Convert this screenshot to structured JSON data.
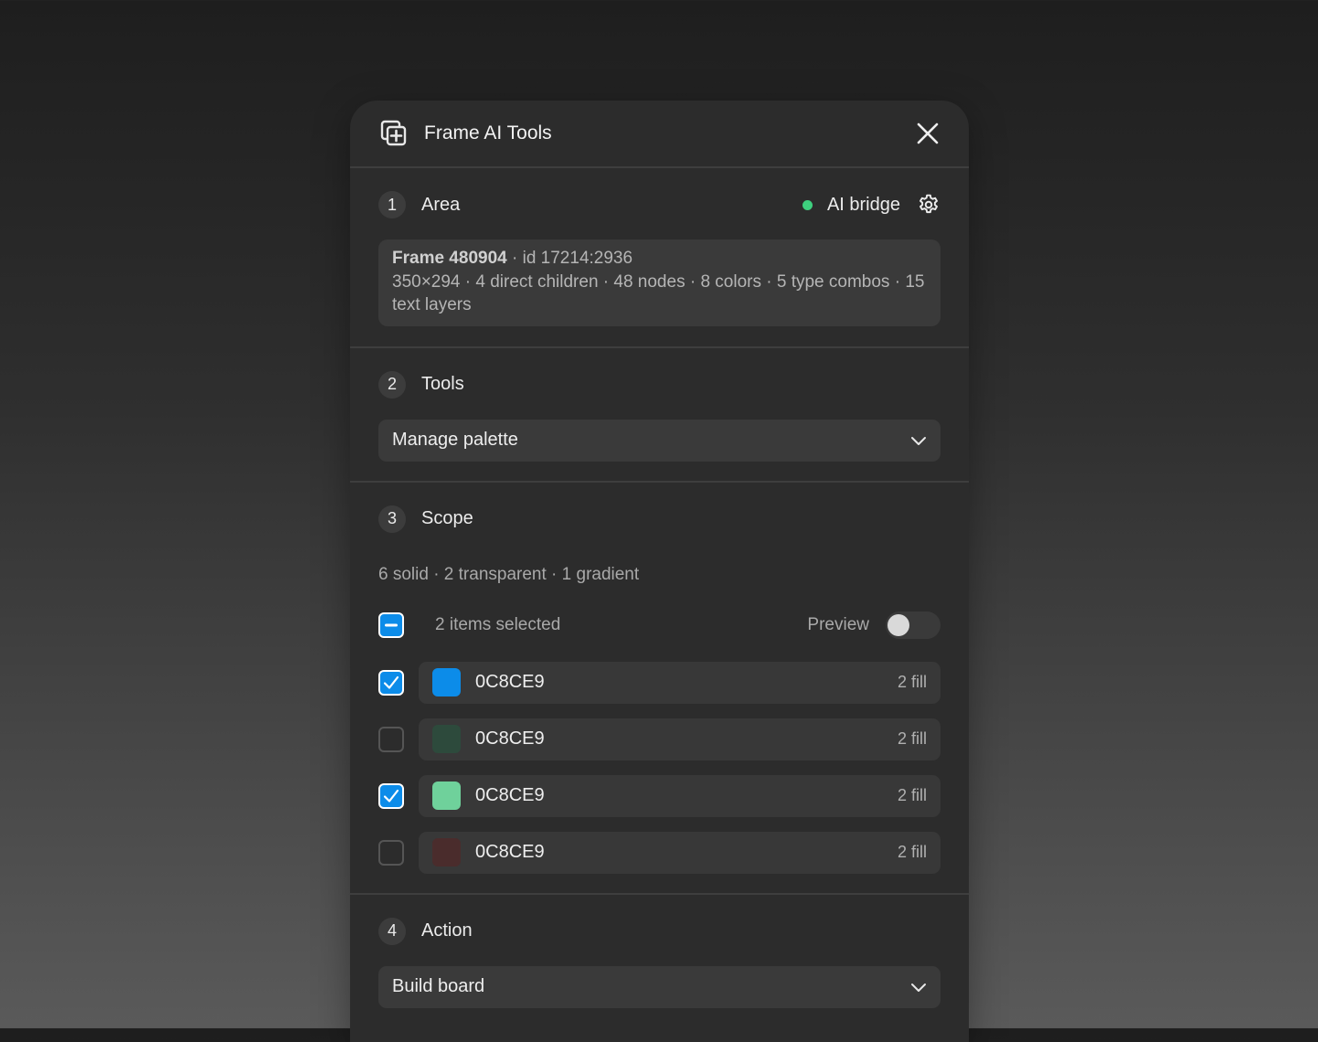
{
  "header": {
    "title": "Frame AI Tools"
  },
  "area": {
    "number": "1",
    "title": "Area",
    "status_label": "AI bridge",
    "status_color": "#3ecf7e",
    "frame_name": "Frame 480904",
    "frame_id": "· id 17214:2936",
    "frame_stats": "350×294 · 4 direct children · 48 nodes · 8 colors · 5 type combos · 15 text layers"
  },
  "tools": {
    "number": "2",
    "title": "Tools",
    "selected": "Manage palette"
  },
  "scope": {
    "number": "3",
    "title": "Scope",
    "summary": "6 solid · 2 transparent · 1 gradient",
    "selection_label": "2 items selected",
    "preview_label": "Preview",
    "preview_on": false,
    "colors": [
      {
        "hex": "0C8CE9",
        "swatch": "#0c8ce9",
        "count": "2 fill",
        "checked": true
      },
      {
        "hex": "0C8CE9",
        "swatch": "#2d4a3c",
        "count": "2 fill",
        "checked": false
      },
      {
        "hex": "0C8CE9",
        "swatch": "#6fd19b",
        "count": "2 fill",
        "checked": true
      },
      {
        "hex": "0C8CE9",
        "swatch": "#4a2c2c",
        "count": "2 fill",
        "checked": false
      }
    ]
  },
  "action": {
    "number": "4",
    "title": "Action",
    "selected": "Build board"
  },
  "colors": {
    "accent": "#0c8ce9",
    "panel_bg": "#2c2c2c",
    "field_bg": "#3a3a3a"
  }
}
